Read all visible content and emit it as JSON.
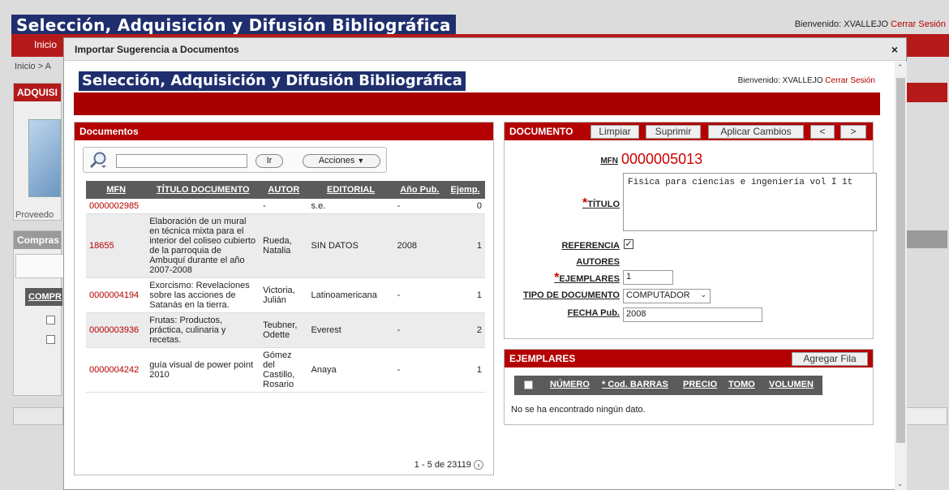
{
  "bg": {
    "app_title": "Selección, Adquisición y Difusión Bibliográfica",
    "welcome": "Bienvenido: XVALLEJO",
    "logout": "Cerrar Sesión",
    "menu_item": "Inicio",
    "breadcrumb": "Inicio > A",
    "panel1_title": "ADQUISI",
    "panel1_label": "Proveedo",
    "panel2_title": "Compras",
    "panel2_col": "COMPR"
  },
  "modal": {
    "title": "Importar Sugerencia a Documentos",
    "close": "×",
    "app_title": "Selección, Adquisición y Difusión Bibliográfica",
    "welcome": "Bienvenido: XVALLEJO",
    "logout": "Cerrar Sesión"
  },
  "documentos": {
    "title": "Documentos",
    "search_value": "",
    "go_button": "Ir",
    "actions_button": "Acciones",
    "columns": [
      "MFN",
      "TÍTULO DOCUMENTO",
      "AUTOR",
      "EDITORIAL",
      "Año Pub.",
      "Ejemp."
    ],
    "rows": [
      {
        "mfn": "0000002985",
        "titulo": "",
        "autor": "-",
        "editorial": "s.e.",
        "anio": "-",
        "ejemp": "0"
      },
      {
        "mfn": "18655",
        "titulo": "Elaboración de un mural en técnica mixta para el interior del coliseo cubierto de la parroquia de Ambuquí durante el año 2007-2008",
        "autor": "Rueda, Natalia",
        "editorial": "SIN DATOS",
        "anio": "2008",
        "ejemp": "1"
      },
      {
        "mfn": "0000004194",
        "titulo": "Exorcismo: Revelaciones sobre las acciones de Satanás en la tierra.",
        "autor": "Victoria, Julián",
        "editorial": "Latinoamericana",
        "anio": "-",
        "ejemp": "1"
      },
      {
        "mfn": "0000003936",
        "titulo": "Frutas: Productos, práctica, culinaria y recetas.",
        "autor": "Teubner, Odette",
        "editorial": "Everest",
        "anio": "-",
        "ejemp": "2"
      },
      {
        "mfn": "0000004242",
        "titulo": "guía visual de power point 2010",
        "autor": "Gómez del Castillo, Rosario",
        "editorial": "Anaya",
        "anio": "-",
        "ejemp": "1"
      }
    ],
    "pager": "1 - 5 de 23119"
  },
  "documento": {
    "title": "DOCUMENTO",
    "btn_limpiar": "Limpiar",
    "btn_suprimir": "Suprimir",
    "btn_aplicar": "Aplicar Cambios",
    "btn_prev": "<",
    "btn_next": ">",
    "mfn_label": "MFN",
    "mfn_value": "0000005013",
    "titulo_label": "TÍTULO",
    "titulo_value": "Fisica para ciencias e ingeniería vol I   1t",
    "referencia_label": "REFERENCIA",
    "referencia_checked": true,
    "autores_label": "AUTORES",
    "ejemplares_label": "EJEMPLARES",
    "ejemplares_value": "1",
    "tipo_label": "TIPO DE DOCUMENTO",
    "tipo_value": "COMPUTADOR",
    "fecha_label": "FECHA Pub.",
    "fecha_value": "2008",
    "required_mark": "*"
  },
  "ejemplares": {
    "title": "EJEMPLARES",
    "add_row": "Agregar Fila",
    "columns": [
      "NÚMERO",
      "* Cod. BARRAS",
      "PRECIO",
      "TOMO",
      "VOLUMEN"
    ],
    "empty": "No se ha encontrado ningún dato."
  },
  "colors": {
    "accent_red": "#b30000",
    "title_blue": "#1f2f6e",
    "header_gray": "#5b5b5b"
  }
}
